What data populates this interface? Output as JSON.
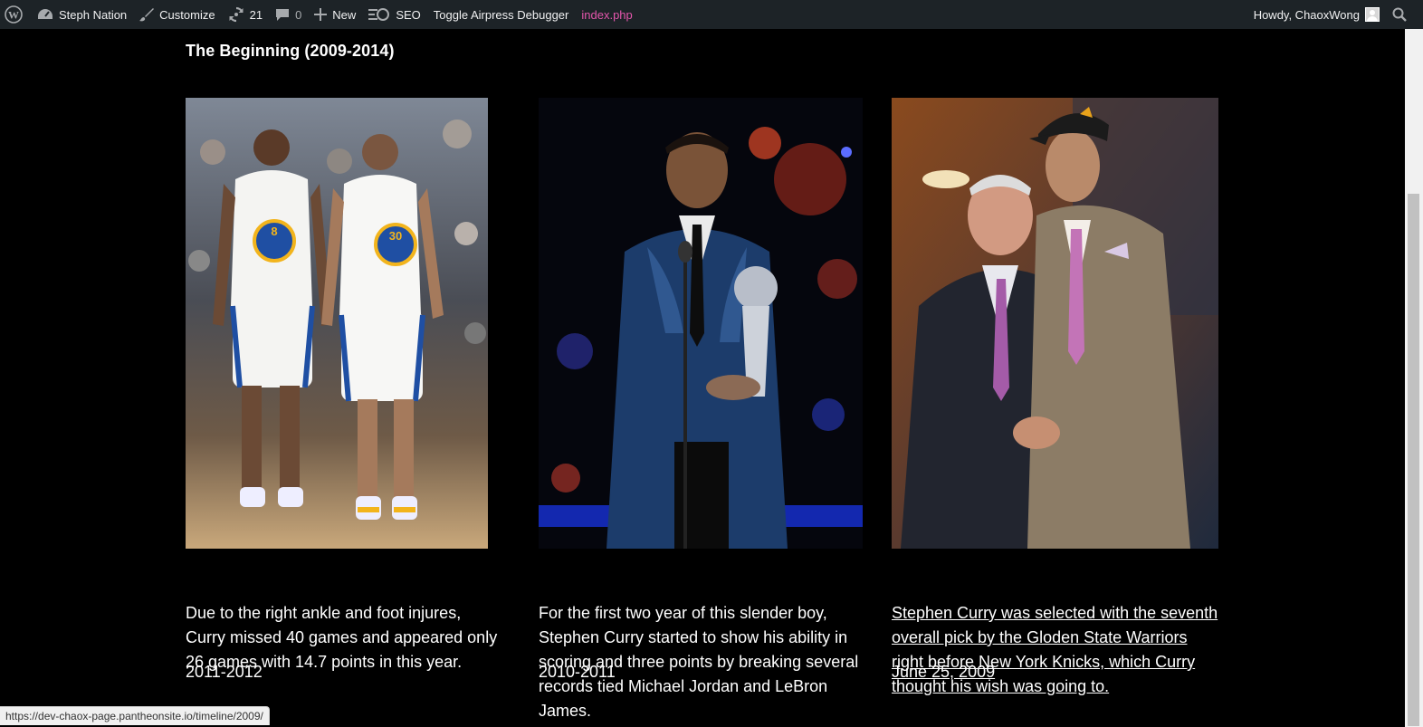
{
  "adminbar": {
    "site_name": "Steph Nation",
    "customize": "Customize",
    "updates_count": "21",
    "comments_count": "0",
    "new_label": "New",
    "seo_label": "SEO",
    "debugger_label": "Toggle Airpress Debugger",
    "template_label": "index.php",
    "howdy": "Howdy, ChaoxWong"
  },
  "main": {
    "title": "The Beginning (2009-2014)",
    "cards": [
      {
        "date": "2011-2012",
        "description": "Due to the right ankle and foot injures, Curry missed 40 games and appeared only 26 games with 14.7 points in this year."
      },
      {
        "date": "2010-2011",
        "description": "For the first two year of this slender boy, Stephen Curry started to show his ability in scoring and three points by breaking several records tied Michael Jordan and LeBron James."
      },
      {
        "date": "June 25, 2009",
        "description": "Stephen Curry was selected with the seventh overall pick by the Gloden State Warriors right before New York Knicks, which Curry thought his wish was going to."
      }
    ]
  },
  "status_bar": {
    "url": "https://dev-chaox-page.pantheonsite.io/timeline/2009/"
  },
  "colors": {
    "admin_bar_bg": "#1d2327",
    "accent_pink": "#e456ac",
    "page_bg": "#000000"
  }
}
